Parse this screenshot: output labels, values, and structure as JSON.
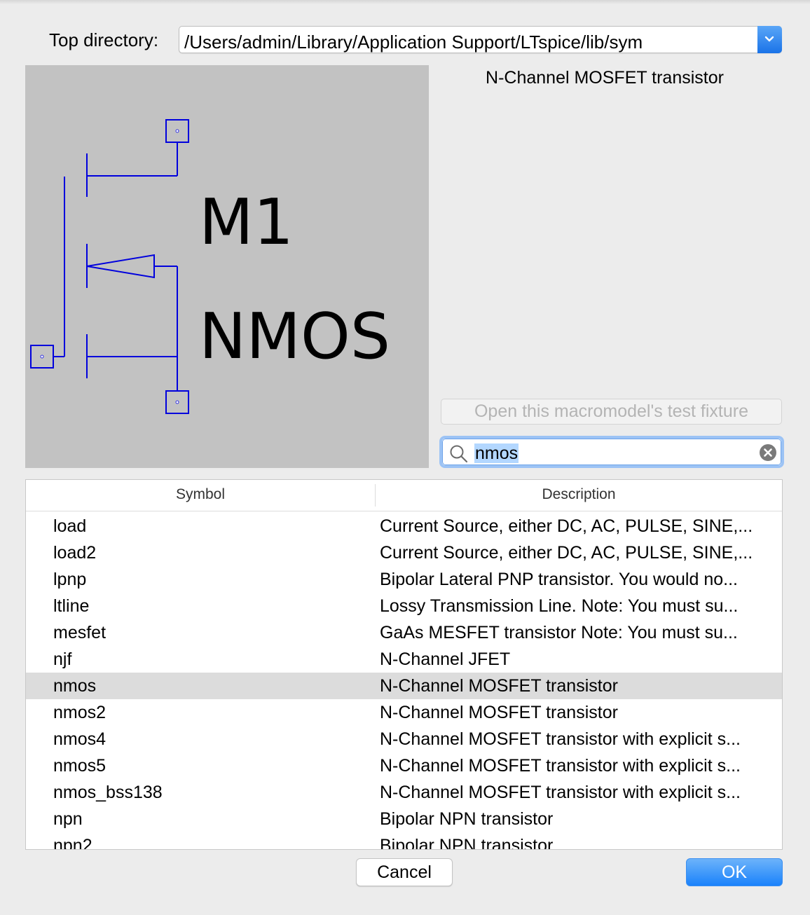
{
  "dialog": {
    "top_directory_label": "Top directory:",
    "top_directory_value": "/Users/admin/Library/Application Support/LTspice/lib/sym",
    "selected_description": "N-Channel MOSFET transistor",
    "fixture_button_label": "Open this macromodel's test fixture",
    "search_value": "nmos",
    "cancel_label": "Cancel",
    "ok_label": "OK"
  },
  "preview": {
    "instance_name": "M1",
    "model_name": "NMOS",
    "wire_color": "#0000dd",
    "background_color": "#c2c2c2"
  },
  "table": {
    "columns": [
      "Symbol",
      "Description"
    ],
    "rows": [
      {
        "symbol": "load",
        "description": "Current Source, either DC, AC, PULSE, SINE,..."
      },
      {
        "symbol": "load2",
        "description": "Current Source, either DC, AC, PULSE, SINE,..."
      },
      {
        "symbol": "lpnp",
        "description": "Bipolar Lateral PNP transistor.  You would no..."
      },
      {
        "symbol": "ltline",
        "description": "Lossy Transmission Line.  Note: You must su..."
      },
      {
        "symbol": "mesfet",
        "description": "GaAs MESFET transistor  Note: You must su..."
      },
      {
        "symbol": "njf",
        "description": "N-Channel JFET"
      },
      {
        "symbol": "nmos",
        "description": "N-Channel MOSFET transistor"
      },
      {
        "symbol": "nmos2",
        "description": "N-Channel MOSFET transistor"
      },
      {
        "symbol": "nmos4",
        "description": "N-Channel MOSFET transistor with explicit s..."
      },
      {
        "symbol": "nmos5",
        "description": "N-Channel MOSFET transistor with explicit s..."
      },
      {
        "symbol": "nmos_bss138",
        "description": "N-Channel MOSFET transistor with explicit s..."
      },
      {
        "symbol": "npn",
        "description": "Bipolar NPN transistor"
      },
      {
        "symbol": "npn2",
        "description": "Bipolar NPN transistor"
      }
    ],
    "selected_symbol": "nmos"
  },
  "colors": {
    "accent": "#1a82fb",
    "selection_row": "#dcdcdc",
    "search_highlight": "#b3d7ff"
  }
}
